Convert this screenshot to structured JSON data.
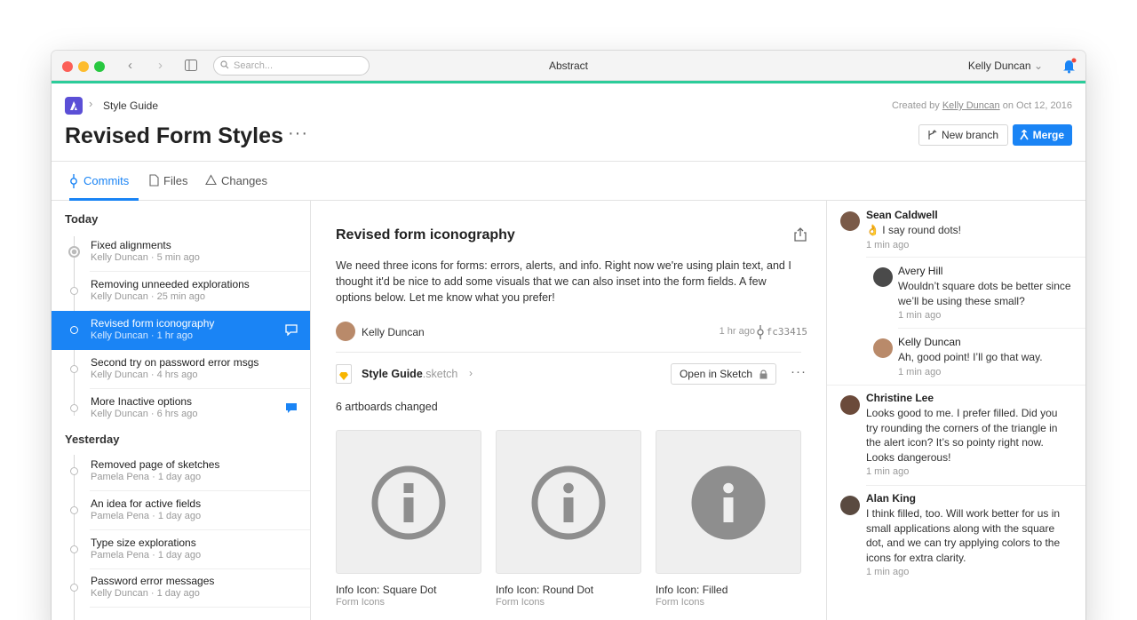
{
  "window": {
    "title": "Abstract",
    "search_placeholder": "Search...",
    "user_name": "Kelly Duncan",
    "accent_color": "#2ccc9a"
  },
  "header": {
    "breadcrumb": "Style Guide",
    "title": "Revised Form Styles",
    "created_prefix": "Created by",
    "created_by": "Kelly Duncan",
    "created_on": "on Oct 12, 2016",
    "new_branch_label": "New branch",
    "merge_label": "Merge"
  },
  "tabs": [
    {
      "label": "Commits",
      "icon": "commit-icon",
      "active": true
    },
    {
      "label": "Files",
      "icon": "file-icon",
      "active": false
    },
    {
      "label": "Changes",
      "icon": "triangle-icon",
      "active": false
    }
  ],
  "commits": {
    "today_label": "Today",
    "yesterday_label": "Yesterday",
    "today": [
      {
        "message": "Fixed alignments",
        "meta": "Kelly Duncan · 5 min ago"
      },
      {
        "message": "Removing unneeded explorations",
        "meta": "Kelly Duncan · 25 min ago"
      },
      {
        "message": "Revised form iconography",
        "meta": "Kelly Duncan · 1 hr ago",
        "selected": true
      },
      {
        "message": "Second try on password error msgs",
        "meta": "Kelly Duncan · 4 hrs ago"
      },
      {
        "message": "More Inactive options",
        "meta": "Kelly Duncan · 6 hrs ago"
      }
    ],
    "yesterday": [
      {
        "message": "Removed page of sketches",
        "meta": "Pamela Pena · 1 day ago"
      },
      {
        "message": "An idea for active fields",
        "meta": "Pamela Pena · 1 day ago"
      },
      {
        "message": "Type size explorations",
        "meta": "Pamela Pena · 1 day ago"
      },
      {
        "message": "Password error messages",
        "meta": "Kelly Duncan · 1 day ago"
      }
    ]
  },
  "detail": {
    "title": "Revised form iconography",
    "body": "We need three icons for forms: errors, alerts, and info. Right now we're using plain text, and I thought it'd be nice to add some visuals that we can also inset into the form fields. A few options below. Let me know what you prefer!",
    "author": "Kelly Duncan",
    "time": "1 hr ago",
    "hash": "fc33415",
    "file_name": "Style Guide",
    "file_ext": ".sketch",
    "open_label": "Open in Sketch",
    "changed_label": "6 artboards changed",
    "artboards": [
      {
        "name": "Info Icon: Square Dot",
        "page": "Form Icons"
      },
      {
        "name": "Info Icon: Round Dot",
        "page": "Form Icons"
      },
      {
        "name": "Info Icon: Filled",
        "page": "Form Icons"
      }
    ]
  },
  "comments": [
    {
      "name": "Sean Caldwell",
      "text": "👌 I say round dots!",
      "time": "1 min ago"
    },
    {
      "name": "Avery Hill",
      "text": "Wouldn’t square dots be better since we’ll be using these small?",
      "time": "1 min ago",
      "reply": true
    },
    {
      "name": "Kelly Duncan",
      "text": "Ah, good point! I’ll go that way.",
      "time": "1 min ago",
      "reply": true
    },
    {
      "name": "Christine Lee",
      "text": "Looks good to me. I prefer filled. Did you try rounding the corners of the triangle in the alert icon? It’s so pointy right now. Looks dangerous!",
      "time": "1 min ago"
    },
    {
      "name": "Alan King",
      "text": "I think filled, too. Will work better for us in small applications along with the square dot, and we can try applying colors to the icons for extra clarity.",
      "time": "1 min ago"
    }
  ]
}
